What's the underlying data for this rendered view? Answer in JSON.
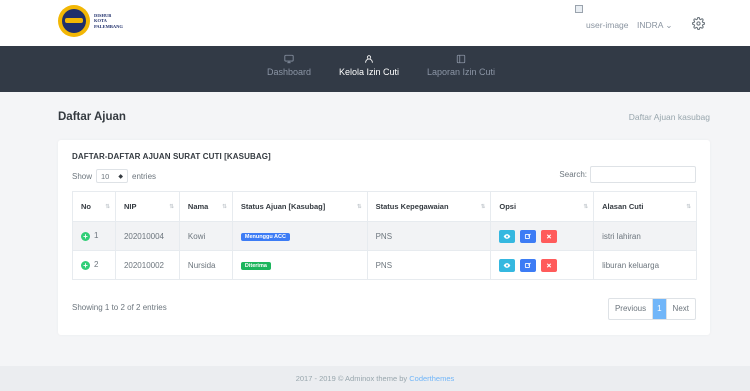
{
  "header": {
    "logo_lines": [
      "DISHUB",
      "KOTA",
      "PALEMBANG"
    ],
    "user_image_alt": "user-image",
    "user_name": "INDRA",
    "caret": "⌄"
  },
  "nav": {
    "items": [
      {
        "label": "Dashboard",
        "icon": "monitor-icon",
        "active": false
      },
      {
        "label": "Kelola Izin Cuti",
        "icon": "user-icon",
        "active": true
      },
      {
        "label": "Laporan Izin Cuti",
        "icon": "layout-icon",
        "active": false
      }
    ]
  },
  "page": {
    "title": "Daftar Ajuan",
    "breadcrumb": "Daftar Ajuan kasubag"
  },
  "card": {
    "title": "DAFTAR-DAFTAR AJUAN SURAT CUTI [KASUBAG]",
    "show_label": "Show",
    "entries_value": "10",
    "entries_label": "entries",
    "search_label": "Search:",
    "search_value": ""
  },
  "table": {
    "headers": [
      "No",
      "NIP",
      "Nama",
      "Status Ajuan [Kasubag]",
      "Status Kepegawaian",
      "Opsi",
      "Alasan Cuti"
    ],
    "rows": [
      {
        "no": "1",
        "nip": "202010004",
        "nama": "Kowi",
        "status": "Menunggu ACC",
        "status_color": "#3d7cf5",
        "kepegawaian": "PNS",
        "alasan": "istri lahiran"
      },
      {
        "no": "2",
        "nip": "202010002",
        "nama": "Nursida",
        "status": "Diterima",
        "status_color": "#1bb55c",
        "kepegawaian": "PNS",
        "alasan": "liburan keluarga"
      }
    ],
    "action_colors": {
      "view": "#35b8e0",
      "edit": "#3d7cf5",
      "delete": "#ff5b5b"
    }
  },
  "footer_info": {
    "showing": "Showing 1 to 2 of 2 entries",
    "prev": "Previous",
    "page": "1",
    "next": "Next"
  },
  "footer": {
    "text": "2017 - 2019 © Adminox theme by ",
    "link": "Coderthemes"
  }
}
